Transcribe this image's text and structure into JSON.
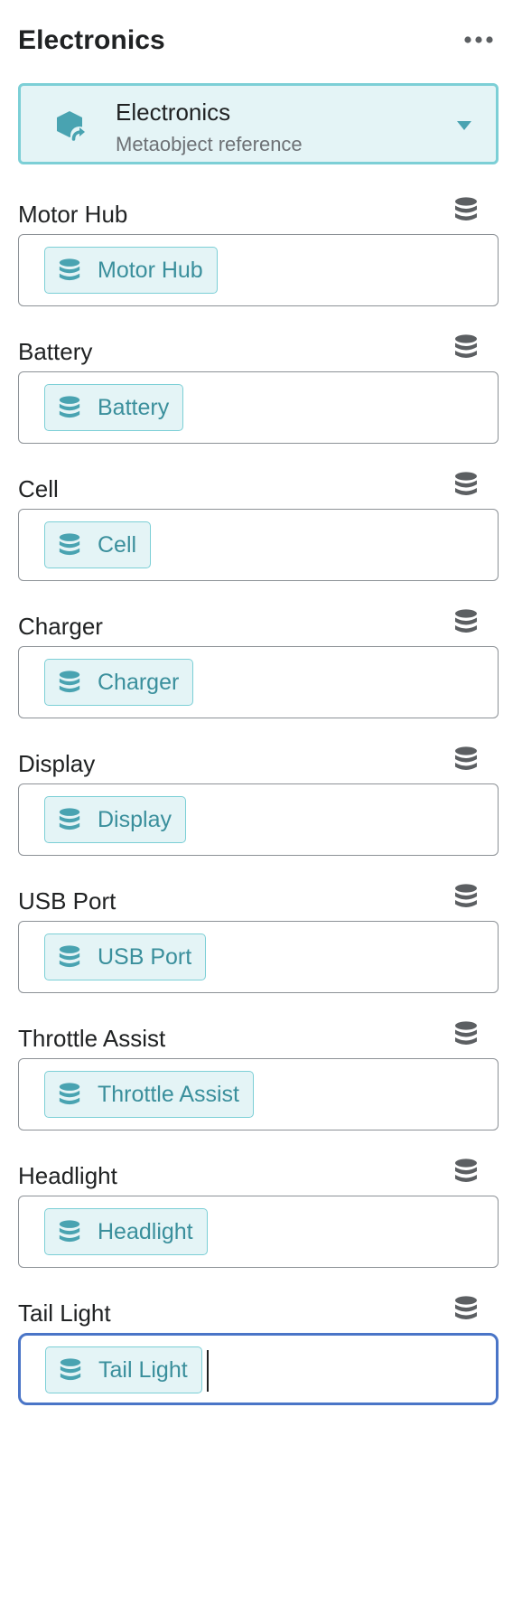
{
  "panel": {
    "title": "Electronics"
  },
  "reference": {
    "title": "Electronics",
    "subtitle": "Metaobject reference"
  },
  "fields": [
    {
      "label": "Motor Hub",
      "value": "Motor Hub"
    },
    {
      "label": "Battery",
      "value": "Battery"
    },
    {
      "label": "Cell",
      "value": "Cell"
    },
    {
      "label": "Charger",
      "value": "Charger"
    },
    {
      "label": "Display",
      "value": "Display"
    },
    {
      "label": "USB Port",
      "value": "USB Port"
    },
    {
      "label": "Throttle Assist",
      "value": "Throttle Assist"
    },
    {
      "label": "Headlight",
      "value": "Headlight"
    },
    {
      "label": "Tail Light",
      "value": "Tail Light",
      "focused": true
    }
  ],
  "icons": {
    "more": "more-horizontal-icon",
    "reference": "metaobject-icon",
    "caret": "caret-down-icon",
    "field_action": "database-icon",
    "chip": "database-icon"
  },
  "colors": {
    "accent": "#7ccfd6",
    "accent_bg": "#e4f4f6",
    "chip_text": "#3a8f9c",
    "focus_border": "#4a75c7",
    "icon_gray": "#5c5f62"
  }
}
